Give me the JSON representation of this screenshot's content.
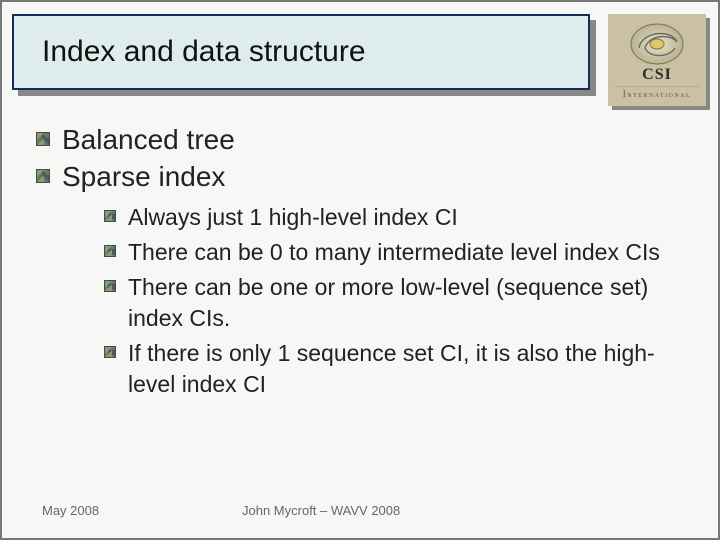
{
  "title": "Index and data structure",
  "logo": {
    "line1": "CSI",
    "line2": "International"
  },
  "bullets": {
    "level1": [
      "Balanced tree",
      "Sparse index"
    ],
    "level2": [
      "Always just 1 high-level index CI",
      "There can be 0 to many intermediate level index CIs",
      "There can be one or more low-level (sequence set) index CIs.",
      "If there is only 1 sequence set CI, it is also the high-level index CI"
    ]
  },
  "footer": {
    "date": "May 2008",
    "author": "John Mycroft – WAVV 2008"
  }
}
